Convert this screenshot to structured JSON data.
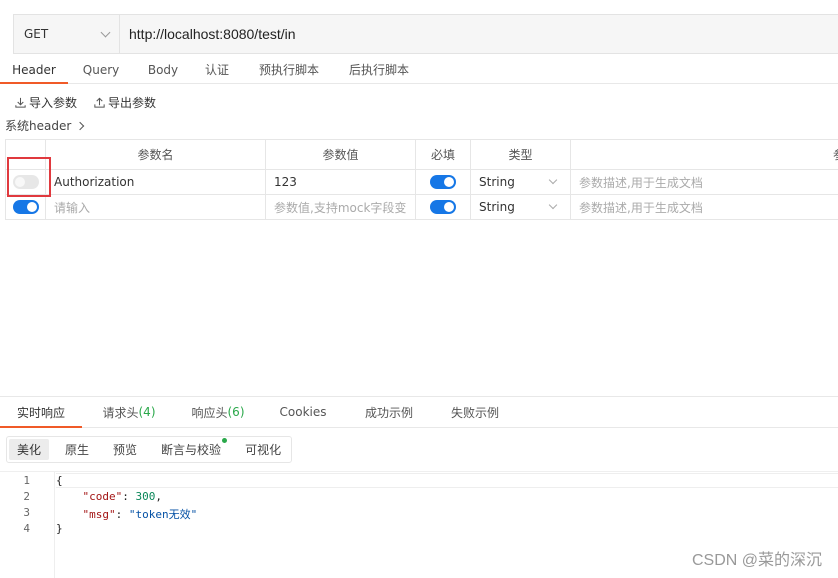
{
  "request": {
    "method": "GET",
    "url": "http://localhost:8080/test/in"
  },
  "tabs": [
    {
      "label": "Header",
      "active": true
    },
    {
      "label": "Query"
    },
    {
      "label": "Body"
    },
    {
      "label": "认证"
    },
    {
      "label": "预执行脚本"
    },
    {
      "label": "后执行脚本"
    }
  ],
  "actions": {
    "import_label": "导入参数",
    "export_label": "导出参数"
  },
  "system_header_label": "系统header",
  "table": {
    "columns": [
      "参数名",
      "参数值",
      "必填",
      "类型",
      "参"
    ],
    "rows": [
      {
        "enabled": false,
        "name": "Authorization",
        "value": "123",
        "required": true,
        "type": "String",
        "description_placeholder": "参数描述,用于生成文档"
      },
      {
        "enabled": true,
        "name_placeholder": "请输入",
        "value_placeholder": "参数值,支持mock字段变",
        "required": true,
        "type": "String",
        "description_placeholder": "参数描述,用于生成文档"
      }
    ]
  },
  "response_tabs": [
    {
      "label": "实时响应",
      "active": true
    },
    {
      "label": "请求头",
      "count": "(4)"
    },
    {
      "label": "响应头",
      "count": "(6)"
    },
    {
      "label": "Cookies"
    },
    {
      "label": "成功示例"
    },
    {
      "label": "失败示例"
    }
  ],
  "format_buttons": [
    {
      "label": "美化",
      "active": true
    },
    {
      "label": "原生"
    },
    {
      "label": "预览"
    },
    {
      "label": "断言与校验"
    },
    {
      "label": "可视化"
    }
  ],
  "response_body": {
    "line_numbers": [
      "1",
      "2",
      "3",
      "4"
    ],
    "open_brace": "{",
    "close_brace": "}",
    "k1": "\"code\"",
    "v1": "300",
    "k2": "\"msg\"",
    "v2": "\"token无效\""
  },
  "watermark": "CSDN @菜的深沉",
  "colors": {
    "accent": "#f05a28",
    "toggle_on": "#1677e6",
    "highlight_box": "#e0393e",
    "count_green": "#2aa84a"
  }
}
